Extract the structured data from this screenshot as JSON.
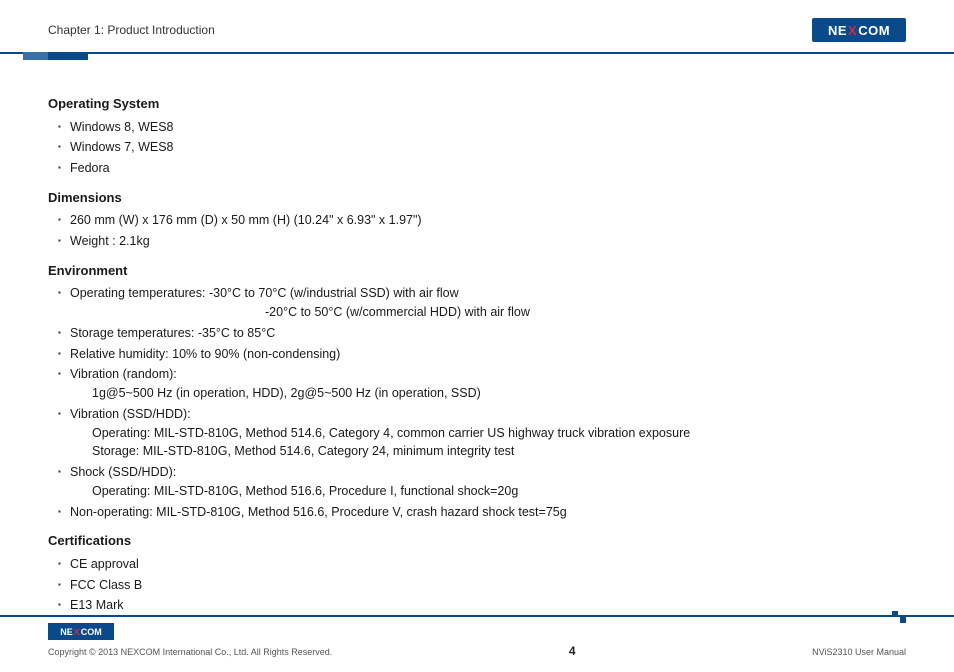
{
  "header": {
    "chapter_title": "Chapter 1: Product Introduction",
    "logo_text_1": "NE",
    "logo_text_x": "X",
    "logo_text_2": "COM"
  },
  "sections": {
    "os": {
      "heading": "Operating System",
      "items": [
        "Windows 8, WES8",
        "Windows 7, WES8",
        "Fedora"
      ]
    },
    "dimensions": {
      "heading": "Dimensions",
      "items": [
        "260 mm (W) x 176 mm (D) x 50 mm (H) (10.24\" x 6.93\" x 1.97\")",
        "Weight : 2.1kg"
      ]
    },
    "environment": {
      "heading": "Environment",
      "op_temp_line1": "Operating temperatures: -30°C to 70°C (w/industrial SSD) with air flow",
      "op_temp_line2": "-20°C to 50°C (w/commercial HDD) with air flow",
      "storage_temp": "Storage temperatures: -35°C to 85°C",
      "humidity": "Relative humidity: 10% to 90% (non-condensing)",
      "vib_random_1": "Vibration (random):",
      "vib_random_2": "1g@5~500 Hz (in operation, HDD), 2g@5~500 Hz (in operation, SSD)",
      "vib_ssd_1": "Vibration (SSD/HDD):",
      "vib_ssd_2": "Operating: MIL-STD-810G, Method 514.6, Category 4, common carrier US highway truck vibration exposure",
      "vib_ssd_3": "Storage: MIL-STD-810G, Method 514.6, Category 24, minimum integrity test",
      "shock_1": "Shock (SSD/HDD):",
      "shock_2": "Operating: MIL-STD-810G, Method 516.6, Procedure I, functional shock=20g",
      "nonop": "Non-operating: MIL-STD-810G, Method 516.6, Procedure V, crash hazard shock test=75g"
    },
    "cert": {
      "heading": "Certifications",
      "items": [
        "CE approval",
        "FCC Class B",
        "E13 Mark"
      ]
    }
  },
  "footer": {
    "copyright": "Copyright © 2013 NEXCOM International Co., Ltd. All Rights Reserved.",
    "page_num": "4",
    "manual": "NViS2310 User Manual"
  }
}
